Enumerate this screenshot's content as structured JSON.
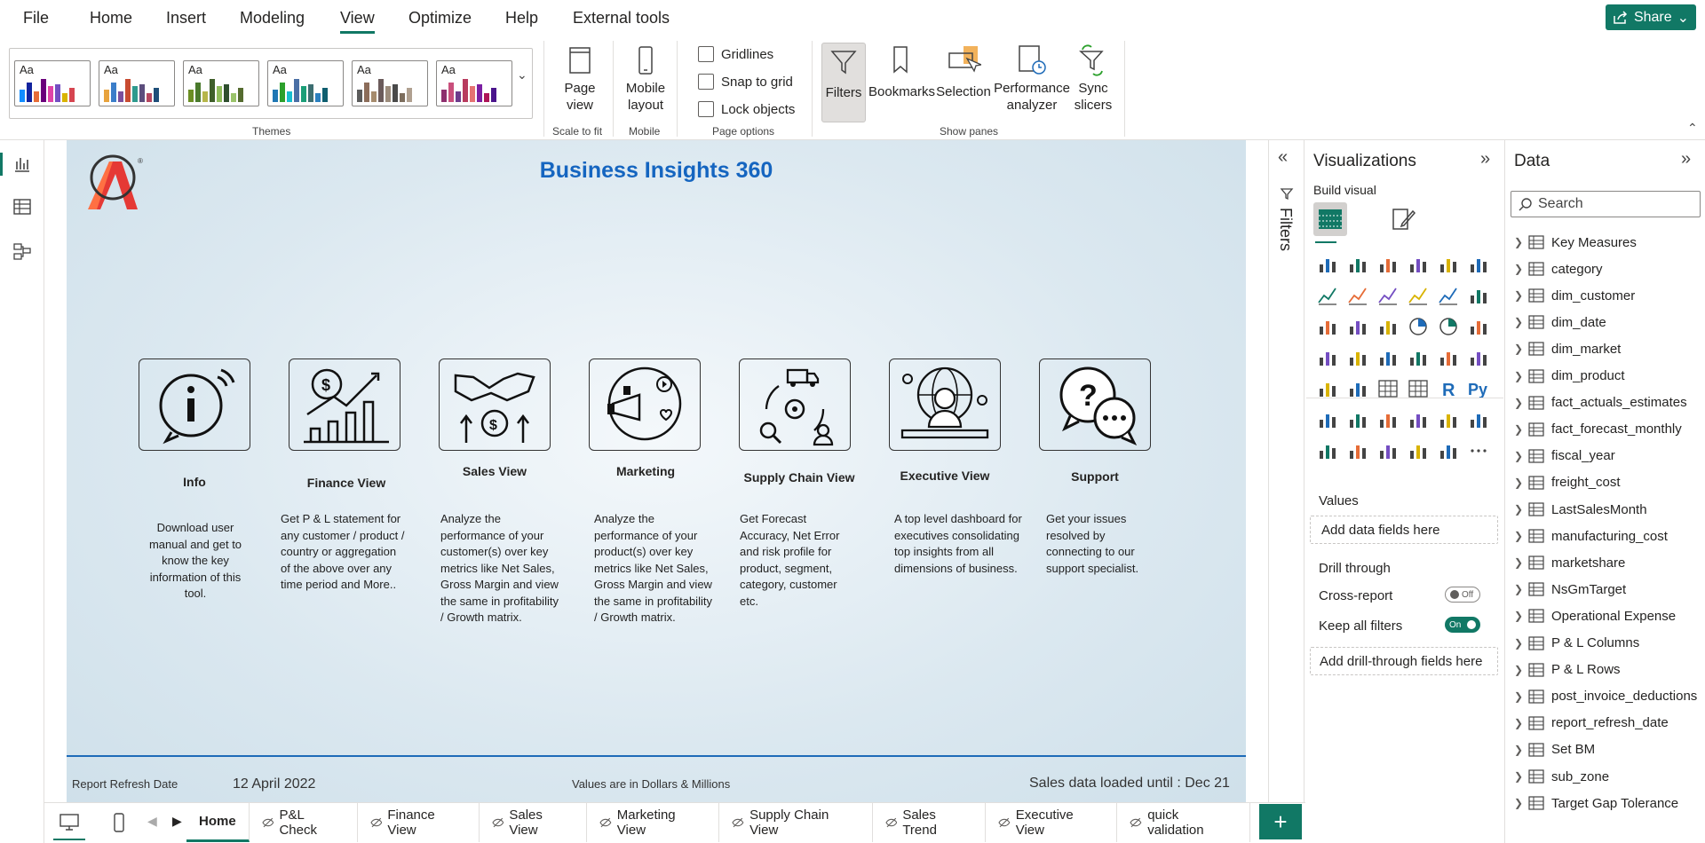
{
  "menu": {
    "items": [
      "File",
      "Home",
      "Insert",
      "Modeling",
      "View",
      "Optimize",
      "Help",
      "External tools"
    ],
    "active": "View",
    "share_label": "Share"
  },
  "ribbon": {
    "themes_label": "Themes",
    "theme_glyph": "Aa",
    "themes": [
      {
        "colors": [
          "#118dff",
          "#12239e",
          "#e66c37",
          "#6b007b",
          "#e044a7",
          "#744ec2",
          "#d9b300",
          "#d64550"
        ]
      },
      {
        "colors": [
          "#e8a33d",
          "#3b7ec9",
          "#7b4f9d",
          "#c84b31",
          "#2e9a8d",
          "#5c4d7d",
          "#b6465f",
          "#1f4e79"
        ]
      },
      {
        "colors": [
          "#6b8e23",
          "#4a7a2c",
          "#b6b64a",
          "#3f5f2a",
          "#8fbc5a",
          "#2f4f2f",
          "#9ac36a",
          "#556b2f"
        ]
      },
      {
        "colors": [
          "#1f77b4",
          "#2ca02c",
          "#17becf",
          "#4a6fa5",
          "#1b9e77",
          "#3c6e71",
          "#2a7fbf",
          "#0e5e6f"
        ]
      },
      {
        "colors": [
          "#5b5b5b",
          "#8c6d5a",
          "#a68b6d",
          "#6b5b5b",
          "#9c8c7c",
          "#4a4a4a",
          "#7d6e5e",
          "#b0a090"
        ]
      },
      {
        "colors": [
          "#8e2f6e",
          "#c94f7c",
          "#6d3b8c",
          "#b83b5e",
          "#e57373",
          "#7b1fa2",
          "#ad1457",
          "#4a148c"
        ]
      }
    ],
    "page_view_label": "Page view",
    "scale_to_fit_label": "Scale to fit",
    "mobile_layout_label": "Mobile layout",
    "mobile_group_label": "Mobile",
    "page_options": [
      "Gridlines",
      "Snap to grid",
      "Lock objects"
    ],
    "page_options_label": "Page options",
    "show_panes": [
      "Filters",
      "Bookmarks",
      "Selection",
      "Performance analyzer",
      "Sync slicers"
    ],
    "show_panes_label": "Show panes"
  },
  "canvas": {
    "title": "Business Insights 360",
    "tiles": [
      {
        "title": "Info",
        "icon": "info-icon",
        "desc": "Download user manual and get to know the key information of this tool."
      },
      {
        "title": "Finance View",
        "icon": "finance-chart-icon",
        "desc": "Get  P & L statement for any customer / product / country or aggregation of the above over any time period and More.."
      },
      {
        "title": "Sales View",
        "icon": "handshake-money-icon",
        "desc": "Analyze the performance of your customer(s) over key metrics like Net Sales, Gross Margin and view the same in profitability / Growth matrix."
      },
      {
        "title": "Marketing",
        "icon": "megaphone-icon",
        "desc": "Analyze the performance of your product(s) over key metrics like Net Sales, Gross Margin and view the same in profitability / Growth matrix."
      },
      {
        "title": "Supply Chain View",
        "icon": "supply-chain-icon",
        "desc": "Get Forecast Accuracy, Net Error and risk profile for product, segment, category, customer etc."
      },
      {
        "title": "Executive View",
        "icon": "executive-icon",
        "desc": "A top level dashboard for executives consolidating top insights from all dimensions of business."
      },
      {
        "title": "Support",
        "icon": "support-chat-icon",
        "desc": "Get your issues resolved by connecting to our support specialist."
      }
    ],
    "footer": {
      "refresh_label": "Report Refresh Date",
      "refresh_date": "12 April 2022",
      "values_note": "Values are in Dollars & Millions",
      "sales_loaded": "Sales data loaded until : Dec 21"
    }
  },
  "filters_pane": {
    "label": "Filters"
  },
  "viz_pane": {
    "title": "Visualizations",
    "build_visual": "Build visual",
    "values_label": "Values",
    "values_placeholder": "Add data fields here",
    "drill_through": "Drill through",
    "cross_report": "Cross-report",
    "cross_report_state": "Off",
    "keep_all_filters": "Keep all filters",
    "keep_all_filters_state": "On",
    "drill_placeholder": "Add drill-through fields here",
    "visual_icons": [
      "stacked-bar-icon",
      "stacked-column-icon",
      "clustered-bar-icon",
      "clustered-column-icon",
      "100-bar-icon",
      "100-column-icon",
      "line-chart-icon",
      "area-chart-icon",
      "stacked-area-icon",
      "line-column-icon",
      "line-clustered-column-icon",
      "ribbon-chart-icon",
      "waterfall-icon",
      "funnel-icon",
      "scatter-icon",
      "pie-icon",
      "donut-icon",
      "treemap-icon",
      "map-icon",
      "filled-map-icon",
      "azure-map-icon",
      "gauge-icon",
      "card-icon",
      "multi-card-icon",
      "kpi-icon",
      "slicer-icon",
      "table-icon",
      "matrix-icon",
      "r-visual-icon",
      "python-visual-icon",
      "decomposition-tree-icon",
      "key-influencers-icon",
      "qa-icon",
      "paginated-icon",
      "trophy-icon",
      "report-icon",
      "smart-narrative-icon",
      "metrics-icon",
      "arcgis-icon",
      "power-apps-icon",
      "power-automate-icon",
      "more-visuals-icon"
    ]
  },
  "data_pane": {
    "title": "Data",
    "search_placeholder": "Search",
    "items": [
      "Key Measures",
      "category",
      "dim_customer",
      "dim_date",
      "dim_market",
      "dim_product",
      "fact_actuals_estimates",
      "fact_forecast_monthly",
      "fiscal_year",
      "freight_cost",
      "LastSalesMonth",
      "manufacturing_cost",
      "marketshare",
      "NsGmTarget",
      "Operational Expense",
      "P & L Columns",
      "P & L Rows",
      "post_invoice_deductions",
      "report_refresh_date",
      "Set BM",
      "sub_zone",
      "Target Gap Tolerance"
    ]
  },
  "tabs": {
    "items": [
      "Home",
      "P&L Check",
      "Finance View",
      "Sales View",
      "Marketing View",
      "Supply Chain View",
      "Sales Trend",
      "Executive View",
      "quick validation"
    ],
    "active": "Home",
    "add_label": "+"
  },
  "colors": {
    "accent": "#117865",
    "title_blue": "#1565c0",
    "footer_line": "#1e6bb8"
  }
}
